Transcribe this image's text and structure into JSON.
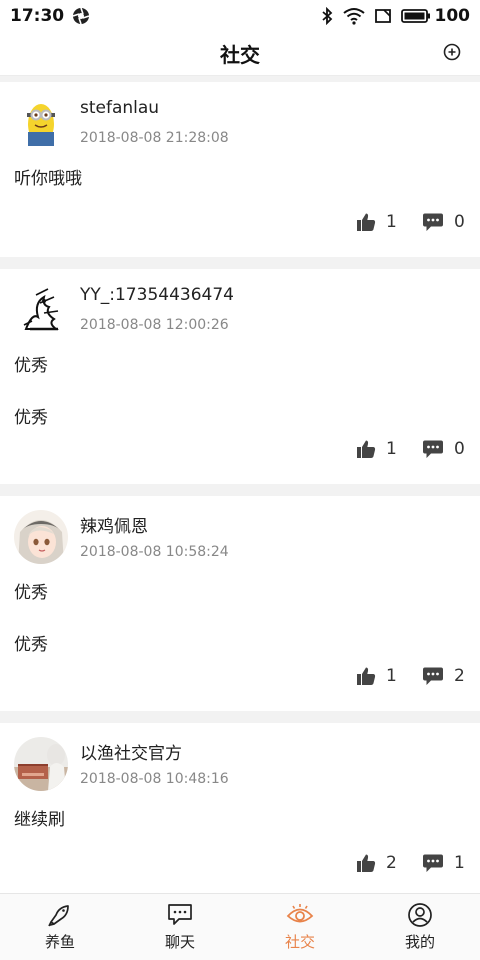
{
  "status_bar": {
    "time": "17:30",
    "battery": "100"
  },
  "header": {
    "title": "社交"
  },
  "posts": [
    {
      "username": "stefanlau",
      "time": "2018-08-08 21:28:08",
      "lines": [
        "听你哦哦"
      ],
      "likes": "1",
      "comments": "0"
    },
    {
      "username": "YY_:17354436474",
      "time": "2018-08-08 12:00:26",
      "lines": [
        "优秀",
        "优秀"
      ],
      "likes": "1",
      "comments": "0"
    },
    {
      "username": "辣鸡佩恩",
      "time": "2018-08-08 10:58:24",
      "lines": [
        "优秀",
        "优秀"
      ],
      "likes": "1",
      "comments": "2"
    },
    {
      "username": "以渔社交官方",
      "time": "2018-08-08 10:48:16",
      "lines": [
        "继续刷"
      ],
      "likes": "2",
      "comments": "1"
    }
  ],
  "tabs": [
    {
      "label": "养鱼",
      "icon": "fish-icon"
    },
    {
      "label": "聊天",
      "icon": "chat-icon"
    },
    {
      "label": "社交",
      "icon": "eye-icon",
      "active": true
    },
    {
      "label": "我的",
      "icon": "person-icon"
    }
  ],
  "colors": {
    "accent": "#e8834a"
  }
}
